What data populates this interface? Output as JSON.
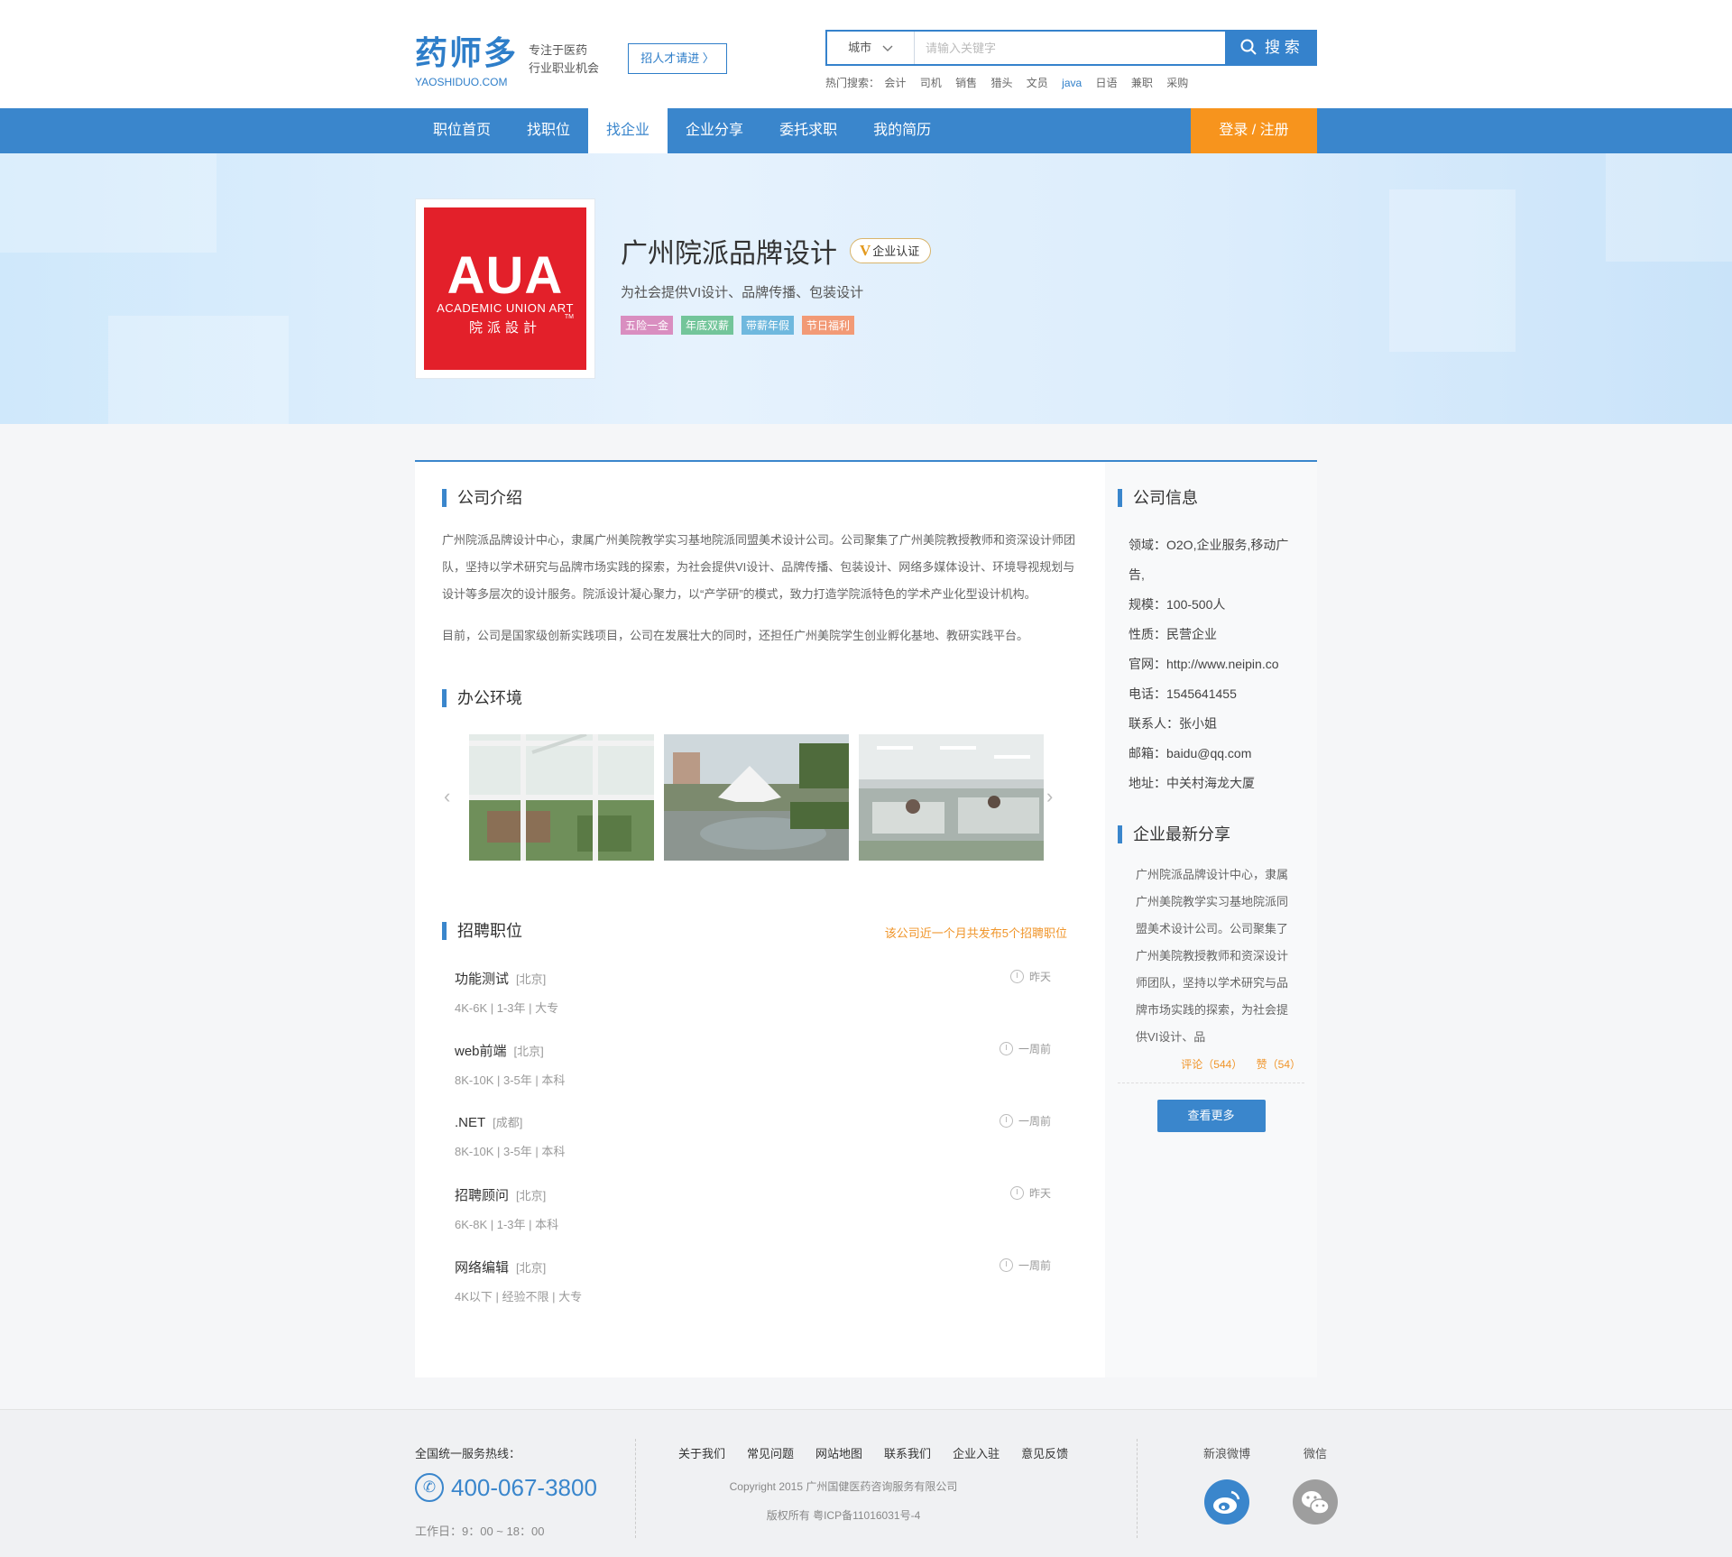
{
  "header": {
    "logo_cn": "药师多",
    "logo_en": "YAOSHIDUO.COM",
    "slogan_line1": "专注于医药",
    "slogan_line2": "行业职业机会",
    "recruit_button": "招人才请进 〉",
    "search": {
      "city": "城市",
      "placeholder": "请输入关键字",
      "button": "搜 索"
    },
    "hot_label": "热门搜索：",
    "hot_terms": [
      "会计",
      "司机",
      "销售",
      "猎头",
      "文员",
      "java",
      "日语",
      "兼职",
      "采购"
    ]
  },
  "nav": {
    "items": [
      "职位首页",
      "找职位",
      "找企业",
      "企业分享",
      "委托求职",
      "我的简历"
    ],
    "active_index": 2,
    "login": "登录 / 注册"
  },
  "company": {
    "logo_big": "AUA",
    "logo_en": "ACADEMIC UNION ART",
    "logo_cn": "院派設計",
    "logo_tm": "TM",
    "name": "广州院派品牌设计",
    "verify_mark": "V",
    "verify": "企业认证",
    "desc": "为社会提供VI设计、品牌传播、包装设计",
    "tags": [
      {
        "label": "五险一金",
        "color": "#d98ec0"
      },
      {
        "label": "年底双薪",
        "color": "#73c59a"
      },
      {
        "label": "带薪年假",
        "color": "#6fb8de"
      },
      {
        "label": "节日福利",
        "color": "#f29a76"
      }
    ]
  },
  "intro": {
    "title": "公司介绍",
    "para1": "广州院派品牌设计中心，隶属广州美院教学实习基地院派同盟美术设计公司。公司聚集了广州美院教授教师和资深设计师团队，坚持以学术研究与品牌市场实践的探索，为社会提供VI设计、品牌传播、包装设计、网络多媒体设计、环境导视规划与设计等多层次的设计服务。院派设计凝心聚力，以“产学研”的模式，致力打造学院派特色的学术产业化型设计机构。",
    "para2": "目前，公司是国家级创新实践项目，公司在发展壮大的同时，还担任广州美院学生创业孵化基地、教研实践平台。"
  },
  "env": {
    "title": "办公环境",
    "prev": "‹",
    "next": "›"
  },
  "jobs": {
    "title": "招聘职位",
    "note": "该公司近一个月共发布5个招聘职位",
    "items": [
      {
        "name": "功能测试",
        "city": "[北京]",
        "meta": "4K-6K  |  1-3年  |  大专",
        "time": "昨天"
      },
      {
        "name": "web前端",
        "city": "[北京]",
        "meta": "8K-10K  |  3-5年  |  本科",
        "time": "一周前"
      },
      {
        "name": ".NET",
        "city": "[成都]",
        "meta": "8K-10K  |  3-5年  |  本科",
        "time": "一周前"
      },
      {
        "name": "招聘顾问",
        "city": "[北京]",
        "meta": "6K-8K  |  1-3年  |  本科",
        "time": "昨天"
      },
      {
        "name": "网络编辑",
        "city": "[北京]",
        "meta": "4K以下  |  经验不限  |  大专",
        "time": "一周前"
      }
    ]
  },
  "info": {
    "title": "公司信息",
    "rows": [
      "领域：O2O,企业服务,移动广告,",
      "规模：100-500人",
      "性质：民营企业",
      "官网：http://www.neipin.co",
      "电话：1545641455",
      "联系人：张小姐",
      "邮箱：baidu@qq.com",
      "地址：中关村海龙大厦"
    ]
  },
  "share": {
    "title": "企业最新分享",
    "text": "广州院派品牌设计中心，隶属广州美院教学实习基地院派同盟美术设计公司。公司聚集了广州美院教授教师和资深设计师团队，坚持以学术研究与品牌市场实践的探索，为社会提供VI设计、品",
    "comments": "评论（544）",
    "likes": "赞（54）",
    "more": "查看更多"
  },
  "footer": {
    "hotline_label": "全国统一服务热线：",
    "phone_icon": "✆",
    "phone": "400-067-3800",
    "hours": "工作日：9：00 ~ 18：00",
    "links": [
      "关于我们",
      "常见问题",
      "网站地图",
      "联系我们",
      "企业入驻",
      "意见反馈"
    ],
    "copyright": "Copyright 2015 广州国健医药咨询服务有限公司",
    "icp": "版权所有    粤ICP备11016031号-4",
    "weibo": "新浪微博",
    "wechat": "微信"
  }
}
